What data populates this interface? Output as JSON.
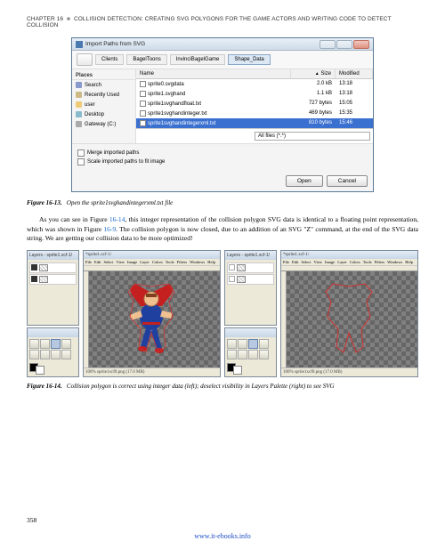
{
  "chapter_header": {
    "prefix": "CHAPTER 16",
    "sep": "■",
    "title": "COLLISION DETECTION: CREATING SVG POLYGONS FOR THE GAME ACTORS AND WRITING CODE TO DETECT COLLISION"
  },
  "dialog1": {
    "title": "Import Paths from SVG",
    "tabs": [
      "Clients",
      "BagelToons",
      "InvinciBagelGame",
      "Shape_Data"
    ],
    "places_header": "Places",
    "places": [
      "Search",
      "Recently Used",
      "user",
      "Desktop",
      "Gateway (C:)"
    ],
    "columns": {
      "name": "Name",
      "size": "Size",
      "modified": "Modified"
    },
    "files": [
      {
        "name": "sprite0.svgdata",
        "size": "2.0 kB",
        "modified": "13:18"
      },
      {
        "name": "sprite1.svghand",
        "size": "1.1 kB",
        "modified": "13:18"
      },
      {
        "name": "sprite1svghandfloat.txt",
        "size": "727 bytes",
        "modified": "15:05"
      },
      {
        "name": "sprite1svghandinteger.txt",
        "size": "469 bytes",
        "modified": "15:35"
      },
      {
        "name": "sprite1svghandintegerxml.txt",
        "size": "810 bytes",
        "modified": "15:46"
      }
    ],
    "selected_index": 4,
    "filter_label": "All files (*.*)",
    "merge_label": "Merge imported paths",
    "scale_label": "Scale imported paths to fit image",
    "open_label": "Open",
    "cancel_label": "Cancel"
  },
  "figure13": {
    "label": "Figure 16-13.",
    "caption": "Open the sprite1svghandintegerxml.txt file"
  },
  "paragraph": {
    "pre": "As you can see in Figure ",
    "ref1": "16-14",
    "mid1": ", this integer representation of the collision polygon SVG data is identical to a floating point representation, which was shown in Figure ",
    "ref2": "16-9",
    "post": ". The collision polygon is now closed, due to an addition of an SVG \"Z\" command, at the end of the SVG data string. We are getting our collision data to be more optimized!"
  },
  "gimp": {
    "layers_title": "Layers - sprite1.xcf-1/",
    "canvas_title_left": "*sprite1.xcf-1/",
    "canvas_title_right": "*sprite1.xcf-1/",
    "menus": [
      "File",
      "Edit",
      "Select",
      "View",
      "Image",
      "Layer",
      "Colors",
      "Tools",
      "Filters",
      "Windows",
      "Help"
    ],
    "status_left": "100%   sprite1xcf0.png (17.0 MB)",
    "status_right": "100%   sprite1xcf0.png (17.0 MB)"
  },
  "figure14": {
    "label": "Figure 16-14.",
    "caption": "Collision polygon is correct using integer data (left); deselect visibility in Layers Palette (right) to see SVG"
  },
  "page_number": "358",
  "footer_link": "www.it-ebooks.info"
}
